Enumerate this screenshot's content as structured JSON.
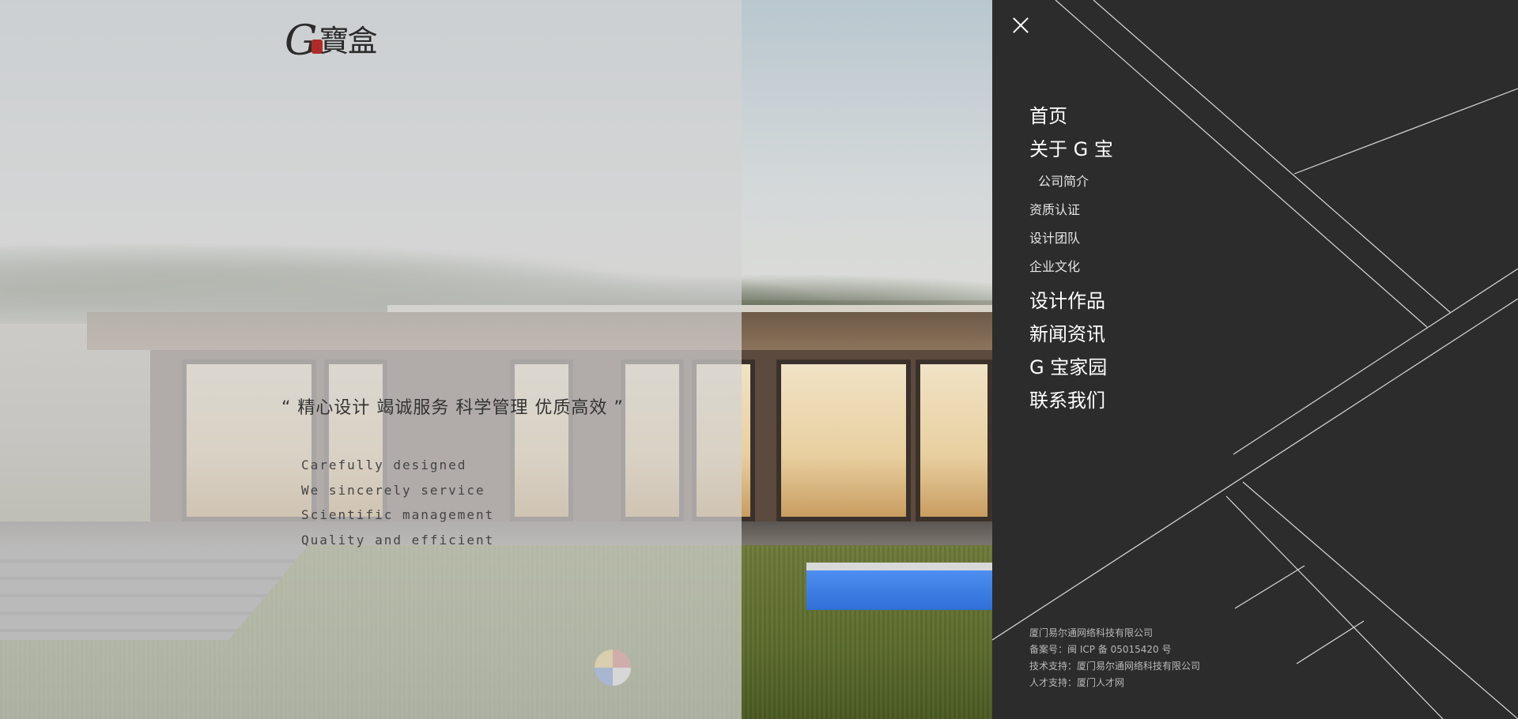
{
  "logo": {
    "letter": "G",
    "characters": "寶盒"
  },
  "slogan": {
    "chinese": "“ 精心设计  竭诚服务  科学管理  优质高效 ”",
    "english": [
      "Carefully designed",
      "We sincerely service",
      "Scientific management",
      "Quality and efficient"
    ]
  },
  "menu": {
    "close_icon": "close-icon",
    "items": {
      "home": "首页",
      "about": "关于 G 宝",
      "about_sub": [
        "公司简介",
        "资质认证",
        "设计团队",
        "企业文化"
      ],
      "works": "设计作品",
      "news": "新闻资讯",
      "home_garden": "G 宝家园",
      "contact": "联系我们"
    }
  },
  "footer": {
    "company": "厦门易尔通网络科技有限公司",
    "icp": "备案号：闽 ICP 备 05015420 号",
    "tech_support": "技术支持：厦门易尔通网络科技有限公司",
    "talent_support": "人才支持：厦门人才网"
  },
  "colors": {
    "panel_bg": "#2c2c2c",
    "menu_text": "#ffffff",
    "footer_text": "#b8b8b8",
    "seal_red": "#b12a2a"
  }
}
